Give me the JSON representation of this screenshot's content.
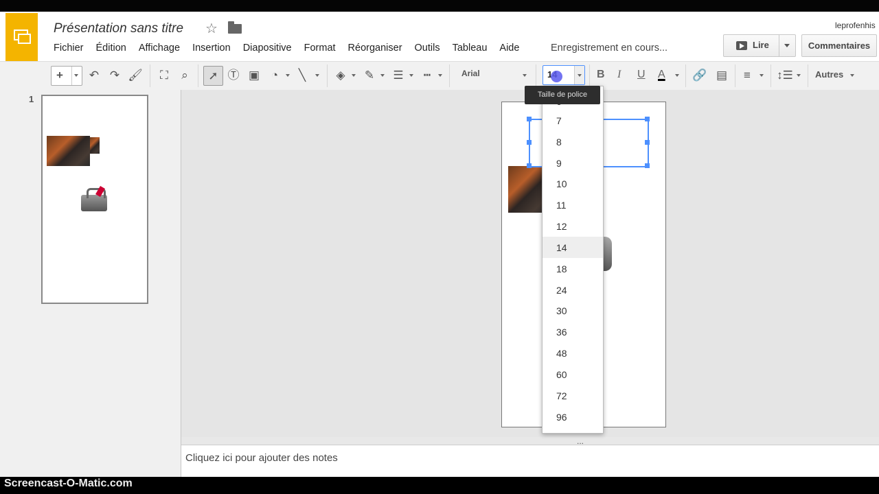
{
  "app": {
    "document_title": "Présentation sans titre",
    "status": "Enregistrement en cours...",
    "user": "leprofenhis"
  },
  "menu": [
    "Fichier",
    "Édition",
    "Affichage",
    "Insertion",
    "Diapositive",
    "Format",
    "Réorganiser",
    "Outils",
    "Tableau",
    "Aide"
  ],
  "buttons": {
    "present": "Lire",
    "comments": "Commentaires"
  },
  "toolbar": {
    "font_family": "Arial",
    "font_size": "14",
    "more": "Autres",
    "tooltip": "Taille de police"
  },
  "font_sizes": [
    "6",
    "7",
    "8",
    "9",
    "10",
    "11",
    "12",
    "14",
    "18",
    "24",
    "30",
    "36",
    "48",
    "60",
    "72",
    "96"
  ],
  "font_size_highlighted": "14",
  "filmstrip": {
    "slide_number": "1"
  },
  "notes": {
    "placeholder": "Cliquez ici pour ajouter des notes"
  },
  "watermark": "Screencast-O-Matic.com",
  "colors": {
    "accent": "#4d90fe",
    "brand": "#f4b400"
  }
}
